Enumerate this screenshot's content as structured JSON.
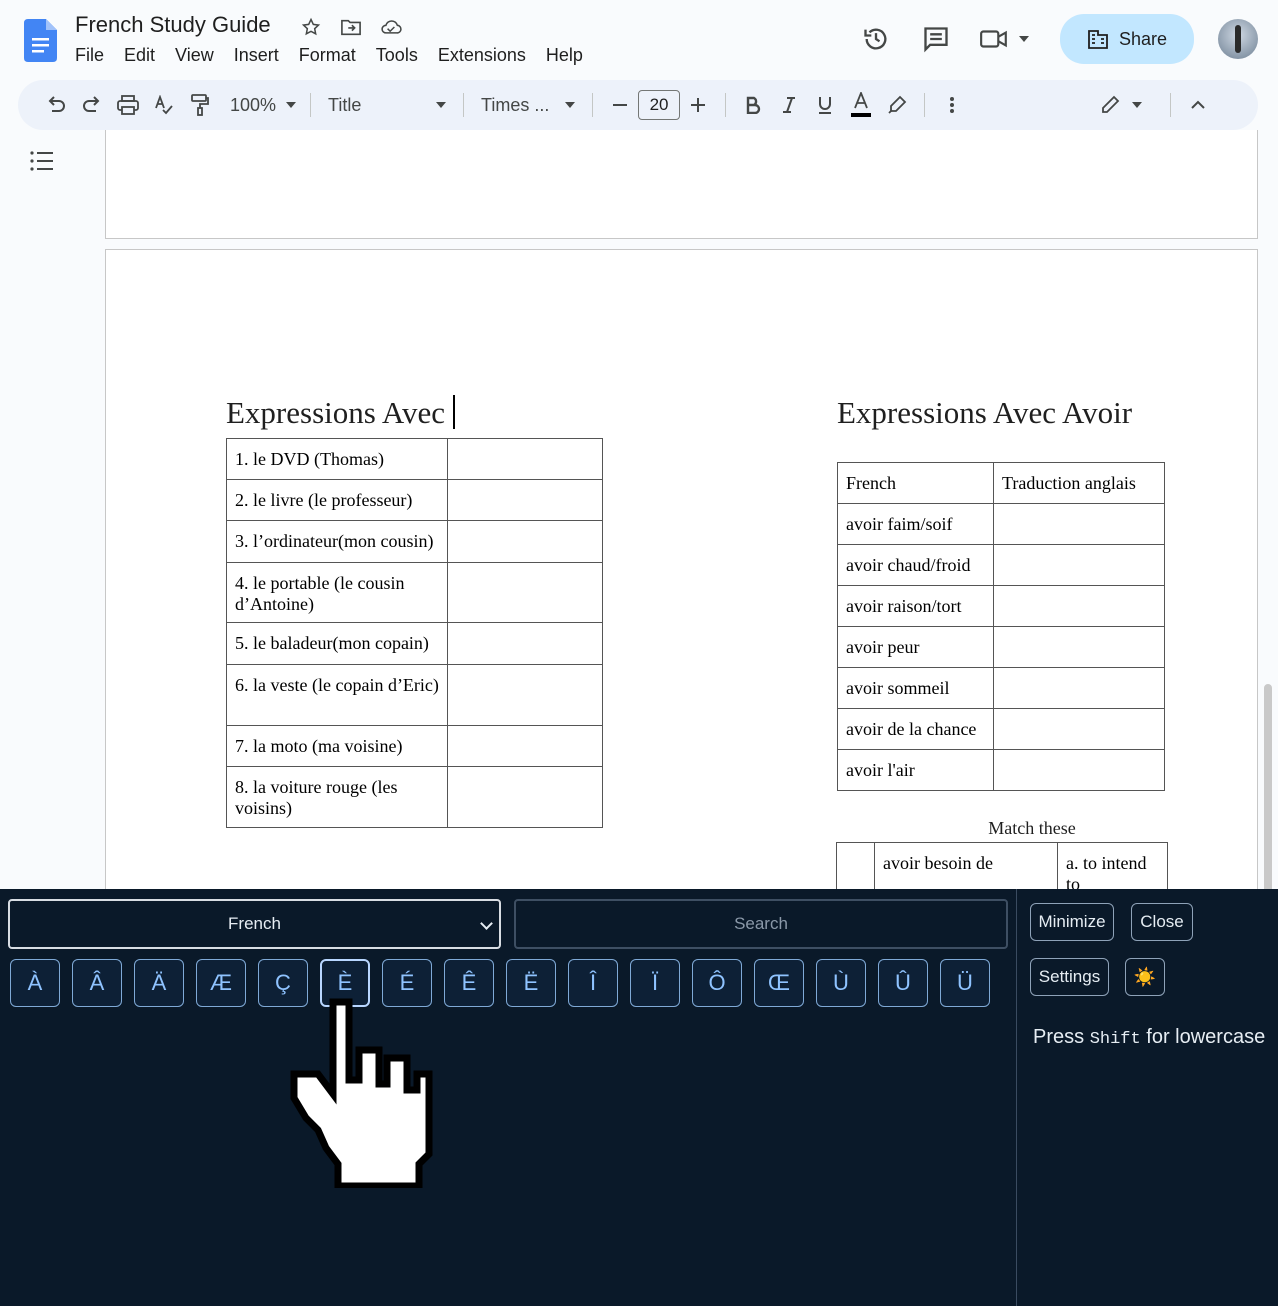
{
  "app": {
    "doc_title": "French Study Guide",
    "menu": [
      "File",
      "Edit",
      "View",
      "Insert",
      "Format",
      "Tools",
      "Extensions",
      "Help"
    ],
    "share_label": "Share"
  },
  "toolbar": {
    "zoom": "100%",
    "style": "Title",
    "font": "Times ...",
    "font_size": "20",
    "colors": {
      "accent": "#0b57d0",
      "share_bg": "#c2e7ff"
    }
  },
  "document": {
    "left_heading": "Expressions Avec",
    "left_rows": [
      "1. le DVD (Thomas)",
      "2. le livre (le professeur)",
      "3. l’ordinateur(mon cousin)",
      "4. le portable (le cousin d’Antoine)",
      "5. le baladeur(mon copain)",
      "6. la veste (le copain d’Eric)",
      "7. la moto (ma voisine)",
      "8. la voiture rouge (les voisins)"
    ],
    "right_heading": "Expressions Avec Avoir",
    "right_header": [
      "French",
      "Traduction anglais"
    ],
    "right_rows": [
      "avoir faim/soif",
      "avoir chaud/froid",
      "avoir raison/tort",
      "avoir peur",
      "avoir sommeil",
      "avoir de la chance",
      "avoir l'air"
    ],
    "match_title": "Match these",
    "match_row": {
      "term": "avoir besoin de",
      "option": "a. to intend to"
    }
  },
  "keyboard": {
    "language": "French",
    "search_placeholder": "Search",
    "keys": [
      "À",
      "Â",
      "Ä",
      "Æ",
      "Ç",
      "È",
      "É",
      "Ê",
      "Ë",
      "Î",
      "Ï",
      "Ô",
      "Œ",
      "Ù",
      "Û",
      "Ü"
    ],
    "active_key": "È",
    "minimize_label": "Minimize",
    "close_label": "Close",
    "settings_label": "Settings",
    "theme_icon": "☀️",
    "hint_prefix": "Press ",
    "hint_key": "Shift",
    "hint_suffix": " for lowercase"
  }
}
